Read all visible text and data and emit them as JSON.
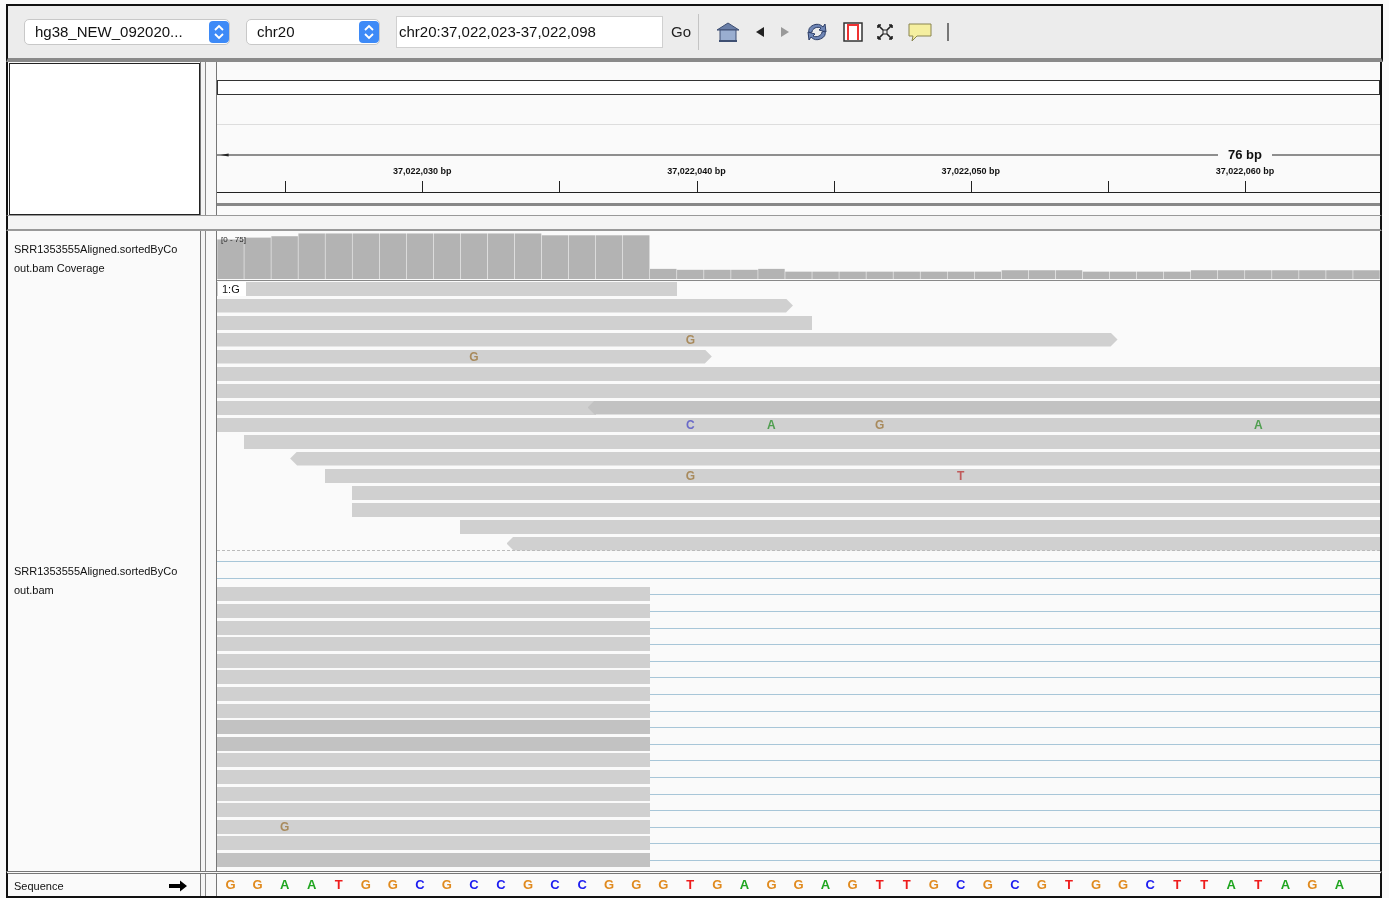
{
  "toolbar": {
    "genome_dropdown": "hg38_NEW_092020...",
    "chromosome_dropdown": "chr20",
    "locus_field": "chr20:37,022,023-37,022,098",
    "go_button": "Go"
  },
  "ruler": {
    "span": "76 bp",
    "ticks": [
      "37,022,030 bp",
      "37,022,040 bp",
      "37,022,050 bp",
      "37,022,060 bp"
    ]
  },
  "coverage_track": {
    "name": [
      "SRR1353555Aligned.sortedByCo",
      "out.bam Coverage"
    ],
    "range": "[0 - 75]"
  },
  "upper_reads": {
    "insertion_label": "1:G",
    "mismatches": [
      {
        "base": "G",
        "color": "#a88a5c"
      },
      {
        "base": "G",
        "color": "#a88a5c"
      },
      {
        "base": "C",
        "color": "#6a6ac8"
      },
      {
        "base": "A",
        "color": "#4f9e4f"
      },
      {
        "base": "G",
        "color": "#a88a5c"
      },
      {
        "base": "A",
        "color": "#4f9e4f"
      },
      {
        "base": "G",
        "color": "#a88a5c"
      },
      {
        "base": "T",
        "color": "#c05a5a"
      }
    ]
  },
  "alignment_track": {
    "name": [
      "SRR1353555Aligned.sortedByCo",
      "out.bam"
    ]
  },
  "lower_reads": {
    "mismatches": [
      {
        "base": "G",
        "color": "#a88a5c"
      }
    ]
  },
  "sequence_track": {
    "name": "Sequence",
    "bases": [
      {
        "base": "G",
        "color": "#e08a1e"
      },
      {
        "base": "G",
        "color": "#e08a1e"
      },
      {
        "base": "A",
        "color": "#1ea51e"
      },
      {
        "base": "A",
        "color": "#1ea51e"
      },
      {
        "base": "T",
        "color": "#ee1c1c"
      },
      {
        "base": "G",
        "color": "#e08a1e"
      },
      {
        "base": "G",
        "color": "#e08a1e"
      },
      {
        "base": "C",
        "color": "#1c1cf0"
      },
      {
        "base": "G",
        "color": "#e08a1e"
      },
      {
        "base": "C",
        "color": "#1c1cf0"
      },
      {
        "base": "C",
        "color": "#1c1cf0"
      },
      {
        "base": "G",
        "color": "#e08a1e"
      },
      {
        "base": "C",
        "color": "#1c1cf0"
      },
      {
        "base": "C",
        "color": "#1c1cf0"
      },
      {
        "base": "G",
        "color": "#e08a1e"
      },
      {
        "base": "G",
        "color": "#e08a1e"
      },
      {
        "base": "G",
        "color": "#e08a1e"
      },
      {
        "base": "T",
        "color": "#ee1c1c"
      },
      {
        "base": "G",
        "color": "#e08a1e"
      },
      {
        "base": "A",
        "color": "#1ea51e"
      },
      {
        "base": "G",
        "color": "#e08a1e"
      },
      {
        "base": "G",
        "color": "#e08a1e"
      },
      {
        "base": "A",
        "color": "#1ea51e"
      },
      {
        "base": "G",
        "color": "#e08a1e"
      },
      {
        "base": "T",
        "color": "#ee1c1c"
      },
      {
        "base": "T",
        "color": "#ee1c1c"
      },
      {
        "base": "G",
        "color": "#e08a1e"
      },
      {
        "base": "C",
        "color": "#1c1cf0"
      },
      {
        "base": "G",
        "color": "#e08a1e"
      },
      {
        "base": "C",
        "color": "#1c1cf0"
      },
      {
        "base": "G",
        "color": "#e08a1e"
      },
      {
        "base": "T",
        "color": "#ee1c1c"
      },
      {
        "base": "G",
        "color": "#e08a1e"
      },
      {
        "base": "G",
        "color": "#e08a1e"
      },
      {
        "base": "C",
        "color": "#1c1cf0"
      },
      {
        "base": "T",
        "color": "#ee1c1c"
      },
      {
        "base": "T",
        "color": "#ee1c1c"
      },
      {
        "base": "A",
        "color": "#1ea51e"
      },
      {
        "base": "T",
        "color": "#ee1c1c"
      },
      {
        "base": "A",
        "color": "#1ea51e"
      },
      {
        "base": "G",
        "color": "#e08a1e"
      },
      {
        "base": "A",
        "color": "#1ea51e"
      }
    ]
  }
}
